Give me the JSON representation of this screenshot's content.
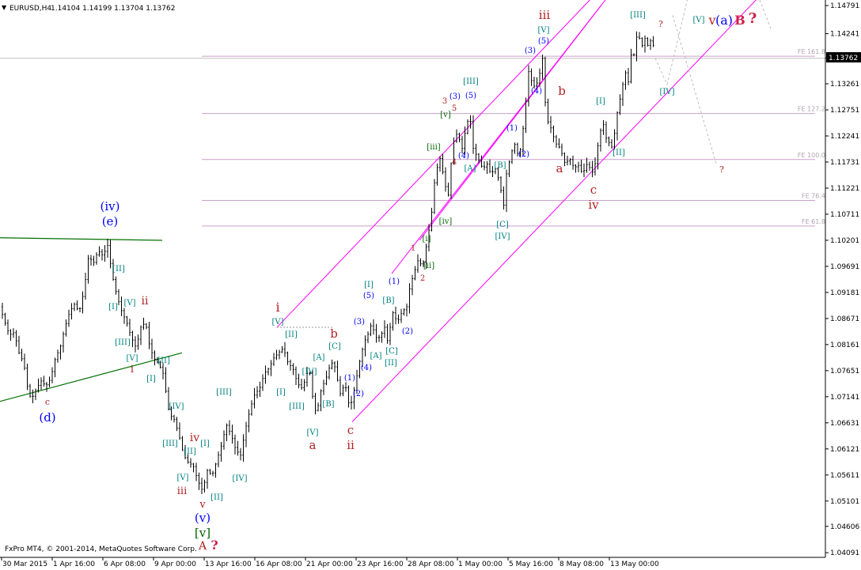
{
  "header": {
    "symbol": "EURUSD,H4",
    "ohlc": "1.14104 1.14199 1.13704 1.13762"
  },
  "footer": {
    "copyright": "FxPro MT4, © 2001-2014, MetaQuotes Software Corp."
  },
  "colors": {
    "background": "#ffffff",
    "candle": "#000000",
    "channel": "#ff00ff",
    "fib": "#c9a0c9",
    "wave_teal": "#008080",
    "wave_blue": "#0000ff",
    "wave_red": "#b22222",
    "wave_green": "#006400",
    "trendline": "#007000",
    "price_tag_bg": "#000000"
  },
  "chart_data": {
    "type": "candlestick",
    "symbol": "EURUSD",
    "timeframe": "H4",
    "current_price": "1.13762",
    "ylim": [
      1.04,
      1.149
    ],
    "y_ticks": [
      "1.14791",
      "1.14241",
      "1.13762",
      "1.13261",
      "1.12751",
      "1.12241",
      "1.11731",
      "1.11221",
      "1.10711",
      "1.10201",
      "1.09691",
      "1.09181",
      "1.08671",
      "1.08161",
      "1.07651",
      "1.07141",
      "1.06631",
      "1.06121",
      "1.05611",
      "1.05101",
      "1.04606",
      "1.04091"
    ],
    "x_ticks": [
      "30 Mar 2015",
      "1 Apr 16:00",
      "6 Apr 08:00",
      "9 Apr 00:00",
      "13 Apr 16:00",
      "16 Apr 08:00",
      "21 Apr 00:00",
      "23 Apr 16:00",
      "28 Apr 08:00",
      "1 May 00:00",
      "5 May 16:00",
      "8 May 08:00",
      "13 May 00:00"
    ],
    "path": [
      [
        0,
        1.089
      ],
      [
        6,
        1.086
      ],
      [
        12,
        1.0835
      ],
      [
        18,
        1.084
      ],
      [
        24,
        1.08
      ],
      [
        30,
        1.078
      ],
      [
        36,
        1.072
      ],
      [
        40,
        1.071
      ],
      [
        46,
        1.073
      ],
      [
        52,
        1.0745
      ],
      [
        58,
        1.0735
      ],
      [
        64,
        1.075
      ],
      [
        70,
        1.079
      ],
      [
        76,
        1.081
      ],
      [
        82,
        1.085
      ],
      [
        88,
        1.088
      ],
      [
        94,
        1.0895
      ],
      [
        100,
        1.088
      ],
      [
        106,
        1.092
      ],
      [
        112,
        1.099
      ],
      [
        118,
        1.0975
      ],
      [
        124,
        1.1
      ],
      [
        130,
        1.099
      ],
      [
        136,
        1.101
      ],
      [
        142,
        1.095
      ],
      [
        148,
        1.091
      ],
      [
        154,
        1.088
      ],
      [
        160,
        1.086
      ],
      [
        166,
        1.083
      ],
      [
        172,
        1.081
      ],
      [
        178,
        1.085
      ],
      [
        184,
        1.086
      ],
      [
        188,
        1.082
      ],
      [
        194,
        1.079
      ],
      [
        200,
        1.078
      ],
      [
        206,
        1.076
      ],
      [
        210,
        1.072
      ],
      [
        214,
        1.068
      ],
      [
        220,
        1.067
      ],
      [
        226,
        1.064
      ],
      [
        232,
        1.06
      ],
      [
        238,
        1.0585
      ],
      [
        244,
        1.058
      ],
      [
        250,
        1.055
      ],
      [
        256,
        1.053
      ],
      [
        262,
        1.057
      ],
      [
        268,
        1.056
      ],
      [
        274,
        1.059
      ],
      [
        280,
        1.062
      ],
      [
        286,
        1.066
      ],
      [
        292,
        1.064
      ],
      [
        298,
        1.061
      ],
      [
        304,
        1.06
      ],
      [
        310,
        1.065
      ],
      [
        316,
        1.069
      ],
      [
        322,
        1.072
      ],
      [
        328,
        1.073
      ],
      [
        334,
        1.076
      ],
      [
        340,
        1.077
      ],
      [
        346,
        1.079
      ],
      [
        352,
        1.08
      ],
      [
        358,
        1.081
      ],
      [
        364,
        1.078
      ],
      [
        370,
        1.077
      ],
      [
        376,
        1.074
      ],
      [
        382,
        1.073
      ],
      [
        388,
        1.076
      ],
      [
        392,
        1.076
      ],
      [
        396,
        1.07
      ],
      [
        400,
        1.068
      ],
      [
        406,
        1.073
      ],
      [
        412,
        1.075
      ],
      [
        418,
        1.078
      ],
      [
        422,
        1.078
      ],
      [
        426,
        1.075
      ],
      [
        430,
        1.072
      ],
      [
        436,
        1.074
      ],
      [
        442,
        1.069
      ],
      [
        448,
        1.073
      ],
      [
        454,
        1.078
      ],
      [
        460,
        1.082
      ],
      [
        466,
        1.084
      ],
      [
        470,
        1.086
      ],
      [
        474,
        1.083
      ],
      [
        480,
        1.083
      ],
      [
        486,
        1.085
      ],
      [
        490,
        1.082
      ],
      [
        496,
        1.088
      ],
      [
        502,
        1.086
      ],
      [
        508,
        1.088
      ],
      [
        514,
        1.089
      ],
      [
        518,
        1.093
      ],
      [
        522,
        1.095
      ],
      [
        528,
        1.098
      ],
      [
        534,
        1.097
      ],
      [
        540,
        1.102
      ],
      [
        546,
        1.108
      ],
      [
        550,
        1.115
      ],
      [
        556,
        1.118
      ],
      [
        560,
        1.115
      ],
      [
        566,
        1.11
      ],
      [
        570,
        1.117
      ],
      [
        574,
        1.122
      ],
      [
        578,
        1.123
      ],
      [
        584,
        1.12
      ],
      [
        590,
        1.125
      ],
      [
        594,
        1.126
      ],
      [
        598,
        1.12
      ],
      [
        604,
        1.118
      ],
      [
        610,
        1.116
      ],
      [
        616,
        1.117
      ],
      [
        620,
        1.115
      ],
      [
        626,
        1.116
      ],
      [
        632,
        1.113
      ],
      [
        636,
        1.108
      ],
      [
        640,
        1.115
      ],
      [
        646,
        1.119
      ],
      [
        650,
        1.121
      ],
      [
        656,
        1.118
      ],
      [
        662,
        1.125
      ],
      [
        668,
        1.135
      ],
      [
        674,
        1.132
      ],
      [
        680,
        1.133
      ],
      [
        686,
        1.138
      ],
      [
        690,
        1.126
      ],
      [
        696,
        1.124
      ],
      [
        702,
        1.121
      ],
      [
        708,
        1.12
      ],
      [
        714,
        1.117
      ],
      [
        720,
        1.118
      ],
      [
        726,
        1.116
      ],
      [
        730,
        1.117
      ],
      [
        736,
        1.115
      ],
      [
        742,
        1.117
      ],
      [
        746,
        1.116
      ],
      [
        750,
        1.115
      ],
      [
        754,
        1.119
      ],
      [
        758,
        1.123
      ],
      [
        762,
        1.125
      ],
      [
        766,
        1.122
      ],
      [
        770,
        1.121
      ],
      [
        774,
        1.12
      ],
      [
        780,
        1.127
      ],
      [
        784,
        1.13
      ],
      [
        790,
        1.135
      ],
      [
        794,
        1.133
      ],
      [
        798,
        1.139
      ],
      [
        802,
        1.138
      ],
      [
        806,
        1.144
      ],
      [
        810,
        1.139
      ],
      [
        814,
        1.142
      ],
      [
        818,
        1.14
      ],
      [
        822,
        1.141
      ],
      [
        826,
        1.14
      ],
      [
        828,
        1.1376
      ]
    ],
    "fib_levels": [
      {
        "label": "FE 161.8",
        "price": 1.138
      },
      {
        "label": "FE 127.2",
        "price": 1.1268
      },
      {
        "label": "FE 100.0",
        "price": 1.1178
      },
      {
        "label": "FE 76.4",
        "price": 1.1098
      },
      {
        "label": "FE 61.8",
        "price": 1.1048
      }
    ],
    "wave_labels": [
      {
        "t": "(iv)",
        "c": "blue",
        "x": 139,
        "y": 266,
        "s": 15
      },
      {
        "t": "(e)",
        "c": "blue",
        "x": 139,
        "y": 285,
        "s": 15
      },
      {
        "t": "c",
        "c": "red",
        "x": 60,
        "y": 512,
        "s": 11
      },
      {
        "t": "(d)",
        "c": "blue",
        "x": 60,
        "y": 533,
        "s": 15
      },
      {
        "t": "[II]",
        "c": "teal",
        "x": 150,
        "y": 343,
        "s": 10
      },
      {
        "t": "[I]",
        "c": "teal",
        "x": 143,
        "y": 391,
        "s": 10
      },
      {
        "t": "[V]",
        "c": "teal",
        "x": 164,
        "y": 386,
        "s": 10
      },
      {
        "t": "ii",
        "c": "red",
        "x": 183,
        "y": 385,
        "s": 14
      },
      {
        "t": "[III]",
        "c": "teal",
        "x": 155,
        "y": 436,
        "s": 10
      },
      {
        "t": "[V]",
        "c": "teal",
        "x": 167,
        "y": 456,
        "s": 10
      },
      {
        "t": "i",
        "c": "red",
        "x": 167,
        "y": 471,
        "s": 13
      },
      {
        "t": "[II]",
        "c": "teal",
        "x": 207,
        "y": 459,
        "s": 10
      },
      {
        "t": "[I]",
        "c": "teal",
        "x": 191,
        "y": 482,
        "s": 10
      },
      {
        "t": "[IV]",
        "c": "teal",
        "x": 223,
        "y": 517,
        "s": 10
      },
      {
        "t": "[III]",
        "c": "teal",
        "x": 215,
        "y": 564,
        "s": 10
      },
      {
        "t": "iv",
        "c": "red",
        "x": 246,
        "y": 558,
        "s": 14
      },
      {
        "t": "[I]",
        "c": "teal",
        "x": 259,
        "y": 564,
        "s": 10
      },
      {
        "t": "[II]",
        "c": "teal",
        "x": 240,
        "y": 574,
        "s": 10
      },
      {
        "t": "[V]",
        "c": "teal",
        "x": 231,
        "y": 607,
        "s": 10
      },
      {
        "t": "iii",
        "c": "red",
        "x": 230,
        "y": 625,
        "s": 13
      },
      {
        "t": "v",
        "c": "red",
        "x": 256,
        "y": 642,
        "s": 13
      },
      {
        "t": "(v)",
        "c": "blue",
        "x": 256,
        "y": 660,
        "s": 15
      },
      {
        "t": "[v]",
        "c": "green",
        "x": 256,
        "y": 679,
        "s": 15
      },
      {
        "t": "A",
        "c": "red",
        "x": 256,
        "y": 695,
        "s": 14
      },
      {
        "t": "?",
        "c": "redb",
        "x": 271,
        "y": 695,
        "s": 16
      },
      {
        "t": "[III]",
        "c": "teal",
        "x": 283,
        "y": 499,
        "s": 10
      },
      {
        "t": "[II]",
        "c": "teal",
        "x": 274,
        "y": 632,
        "s": 10
      },
      {
        "t": "[IV]",
        "c": "teal",
        "x": 303,
        "y": 608,
        "s": 10
      },
      {
        "t": "[V]",
        "c": "teal",
        "x": 351,
        "y": 410,
        "s": 10
      },
      {
        "t": "i",
        "c": "red",
        "x": 351,
        "y": 394,
        "s": 16
      },
      {
        "t": "[II]",
        "c": "teal",
        "x": 368,
        "y": 426,
        "s": 10
      },
      {
        "t": "[IV]",
        "c": "teal",
        "x": 391,
        "y": 473,
        "s": 10
      },
      {
        "t": "[I]",
        "c": "teal",
        "x": 355,
        "y": 499,
        "s": 10
      },
      {
        "t": "[III]",
        "c": "teal",
        "x": 375,
        "y": 517,
        "s": 10
      },
      {
        "t": "[A]",
        "c": "teal",
        "x": 403,
        "y": 455,
        "s": 10
      },
      {
        "t": "[C]",
        "c": "teal",
        "x": 423,
        "y": 441,
        "s": 10
      },
      {
        "t": "b",
        "c": "red",
        "x": 422,
        "y": 427,
        "s": 15
      },
      {
        "t": "[B]",
        "c": "teal",
        "x": 415,
        "y": 514,
        "s": 10
      },
      {
        "t": "[V]",
        "c": "teal",
        "x": 395,
        "y": 550,
        "s": 10
      },
      {
        "t": "a",
        "c": "red",
        "x": 395,
        "y": 568,
        "s": 15
      },
      {
        "t": "c",
        "c": "red",
        "x": 443,
        "y": 549,
        "s": 15
      },
      {
        "t": "ii",
        "c": "red",
        "x": 443,
        "y": 568,
        "s": 15
      },
      {
        "t": "(1)",
        "c": "blue",
        "x": 442,
        "y": 481,
        "s": 10
      },
      {
        "t": "(2)",
        "c": "blue",
        "x": 453,
        "y": 501,
        "s": 10
      },
      {
        "t": "(3)",
        "c": "blue",
        "x": 454,
        "y": 410,
        "s": 10
      },
      {
        "t": "(4)",
        "c": "blue",
        "x": 463,
        "y": 468,
        "s": 10
      },
      {
        "t": "(5)",
        "c": "blue",
        "x": 466,
        "y": 377,
        "s": 10
      },
      {
        "t": "[I]",
        "c": "teal",
        "x": 466,
        "y": 363,
        "s": 10
      },
      {
        "t": "[A]",
        "c": "teal",
        "x": 475,
        "y": 453,
        "s": 10
      },
      {
        "t": "[B]",
        "c": "teal",
        "x": 491,
        "y": 383,
        "s": 10
      },
      {
        "t": "(1)",
        "c": "blue",
        "x": 498,
        "y": 359,
        "s": 10
      },
      {
        "t": "[C]",
        "c": "teal",
        "x": 495,
        "y": 447,
        "s": 10
      },
      {
        "t": "[II]",
        "c": "teal",
        "x": 494,
        "y": 462,
        "s": 10
      },
      {
        "t": "(2)",
        "c": "blue",
        "x": 515,
        "y": 422,
        "s": 10
      },
      {
        "t": "1",
        "c": "red",
        "x": 522,
        "y": 317,
        "s": 10
      },
      {
        "t": "2",
        "c": "red",
        "x": 534,
        "y": 355,
        "s": 10
      },
      {
        "t": "[i]",
        "c": "green",
        "x": 539,
        "y": 305,
        "s": 10
      },
      {
        "t": "[ii]",
        "c": "green",
        "x": 542,
        "y": 339,
        "s": 10
      },
      {
        "t": "[iii]",
        "c": "green",
        "x": 548,
        "y": 189,
        "s": 10
      },
      {
        "t": "[iv]",
        "c": "green",
        "x": 563,
        "y": 283,
        "s": 10
      },
      {
        "t": "[v]",
        "c": "green",
        "x": 563,
        "y": 148,
        "s": 10
      },
      {
        "t": "3",
        "c": "red",
        "x": 562,
        "y": 131,
        "s": 10
      },
      {
        "t": "5",
        "c": "red",
        "x": 574,
        "y": 140,
        "s": 10
      },
      {
        "t": "4",
        "c": "red",
        "x": 574,
        "y": 208,
        "s": 10
      },
      {
        "t": "(3)",
        "c": "blue",
        "x": 575,
        "y": 125,
        "s": 10
      },
      {
        "t": "(4)",
        "c": "blue",
        "x": 586,
        "y": 200,
        "s": 10
      },
      {
        "t": "(5)",
        "c": "blue",
        "x": 595,
        "y": 124,
        "s": 10
      },
      {
        "t": "[III]",
        "c": "teal",
        "x": 595,
        "y": 106,
        "s": 10
      },
      {
        "t": "[A]",
        "c": "teal",
        "x": 594,
        "y": 216,
        "s": 10
      },
      {
        "t": "[B]",
        "c": "teal",
        "x": 632,
        "y": 212,
        "s": 10
      },
      {
        "t": "[C]",
        "c": "teal",
        "x": 635,
        "y": 287,
        "s": 10
      },
      {
        "t": "[IV]",
        "c": "teal",
        "x": 635,
        "y": 302,
        "s": 10
      },
      {
        "t": "(1)",
        "c": "blue",
        "x": 647,
        "y": 165,
        "s": 10
      },
      {
        "t": "(2)",
        "c": "blue",
        "x": 662,
        "y": 198,
        "s": 10
      },
      {
        "t": "(3)",
        "c": "blue",
        "x": 670,
        "y": 67,
        "s": 10
      },
      {
        "t": "(4)",
        "c": "blue",
        "x": 678,
        "y": 118,
        "s": 10
      },
      {
        "t": "(5)",
        "c": "blue",
        "x": 687,
        "y": 55,
        "s": 10
      },
      {
        "t": "[V]",
        "c": "teal",
        "x": 687,
        "y": 41,
        "s": 10
      },
      {
        "t": "iii",
        "c": "red",
        "x": 688,
        "y": 24,
        "s": 15
      },
      {
        "t": "b",
        "c": "red",
        "x": 710,
        "y": 120,
        "s": 15
      },
      {
        "t": "a",
        "c": "red",
        "x": 707,
        "y": 218,
        "s": 15
      },
      {
        "t": "c",
        "c": "red",
        "x": 750,
        "y": 245,
        "s": 15
      },
      {
        "t": "iv",
        "c": "red",
        "x": 750,
        "y": 264,
        "s": 15
      },
      {
        "t": "[I]",
        "c": "teal",
        "x": 759,
        "y": 131,
        "s": 10
      },
      {
        "t": "[II]",
        "c": "teal",
        "x": 782,
        "y": 196,
        "s": 10
      },
      {
        "t": "[III]",
        "c": "teal",
        "x": 806,
        "y": 22,
        "s": 10
      },
      {
        "t": "[IV]",
        "c": "teal",
        "x": 843,
        "y": 119,
        "s": 10
      },
      {
        "t": "?",
        "c": "red",
        "x": 835,
        "y": 34,
        "s": 11
      },
      {
        "t": "[V]",
        "c": "teal",
        "x": 883,
        "y": 28,
        "s": 10
      },
      {
        "t": "v",
        "c": "red",
        "x": 900,
        "y": 31,
        "s": 16
      },
      {
        "t": "(a)",
        "c": "blue",
        "x": 915,
        "y": 31,
        "s": 16
      },
      {
        "t": "B",
        "c": "redb",
        "x": 935,
        "y": 31,
        "s": 16
      },
      {
        "t": "?",
        "c": "redb",
        "x": 951,
        "y": 29,
        "s": 18
      },
      {
        "t": "?",
        "c": "red",
        "x": 912,
        "y": 218,
        "s": 11
      }
    ]
  }
}
